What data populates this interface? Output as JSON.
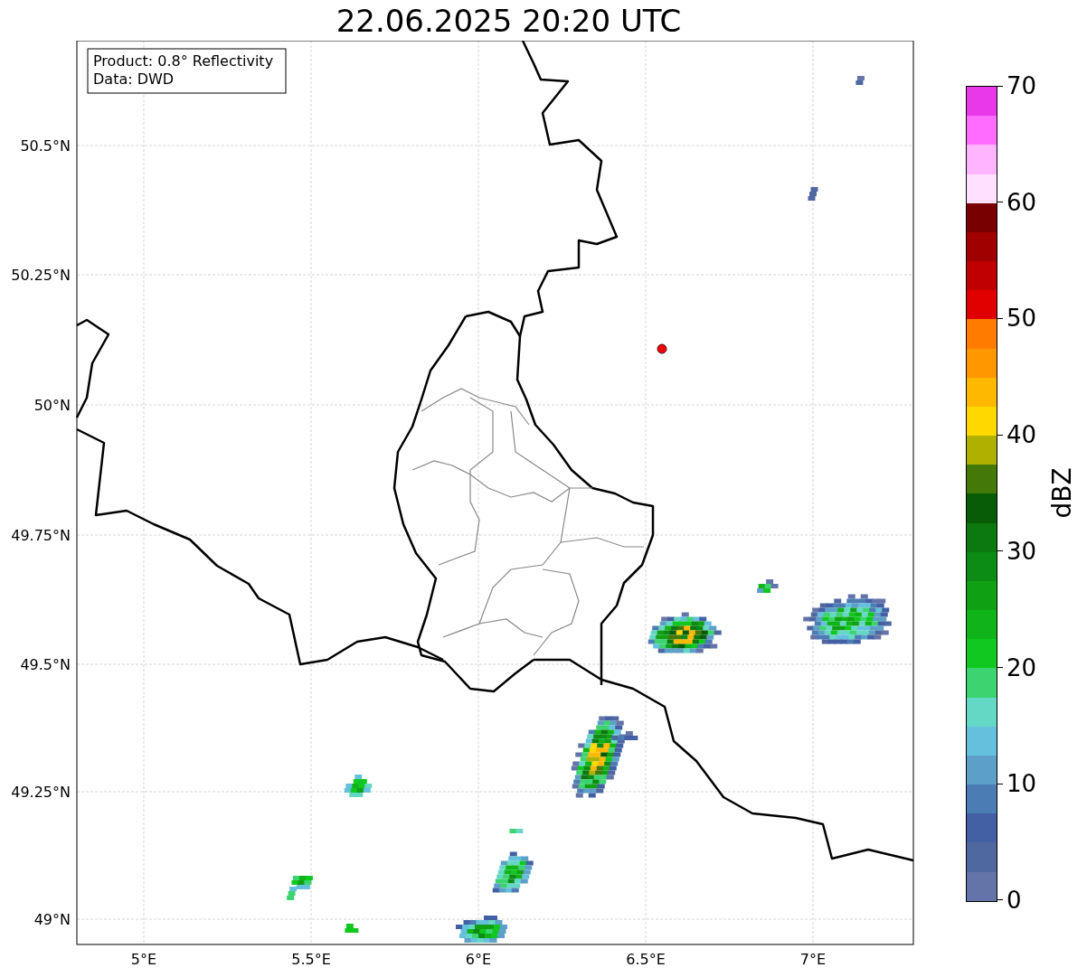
{
  "title": "22.06.2025 20:20 UTC",
  "info_box": [
    "Product: 0.8° Reflectivity",
    "Data: DWD"
  ],
  "map": {
    "x_ticks": [
      "5°E",
      "5.5°E",
      "6°E",
      "6.5°E",
      "7°E"
    ],
    "y_ticks": [
      "50.5°N",
      "50.25°N",
      "50°N",
      "49.75°N",
      "49.5°N",
      "49.25°N",
      "49°N"
    ]
  },
  "colorbar": {
    "label": "dBZ",
    "ticks": [
      "70",
      "60",
      "50",
      "40",
      "30",
      "20",
      "10",
      "0"
    ],
    "bands": [
      {
        "color": "#e838e8"
      },
      {
        "color": "#ff6cff"
      },
      {
        "color": "#ffb4ff"
      },
      {
        "color": "#ffe0ff"
      },
      {
        "color": "#780000"
      },
      {
        "color": "#a00000"
      },
      {
        "color": "#c00000"
      },
      {
        "color": "#e00000"
      },
      {
        "color": "#ff7c00"
      },
      {
        "color": "#ff9800"
      },
      {
        "color": "#ffb800"
      },
      {
        "color": "#ffd800"
      },
      {
        "color": "#b0b000"
      },
      {
        "color": "#447808"
      },
      {
        "color": "#085c08"
      },
      {
        "color": "#0c7810"
      },
      {
        "color": "#0c8c14"
      },
      {
        "color": "#10a014"
      },
      {
        "color": "#10b418"
      },
      {
        "color": "#10c820"
      },
      {
        "color": "#3cd470"
      },
      {
        "color": "#64d8c4"
      },
      {
        "color": "#64c0dc"
      },
      {
        "color": "#5ca0c8"
      },
      {
        "color": "#4c7cb4"
      },
      {
        "color": "#4460a4"
      },
      {
        "color": "#5068a0"
      },
      {
        "color": "#6474a8"
      }
    ]
  }
}
